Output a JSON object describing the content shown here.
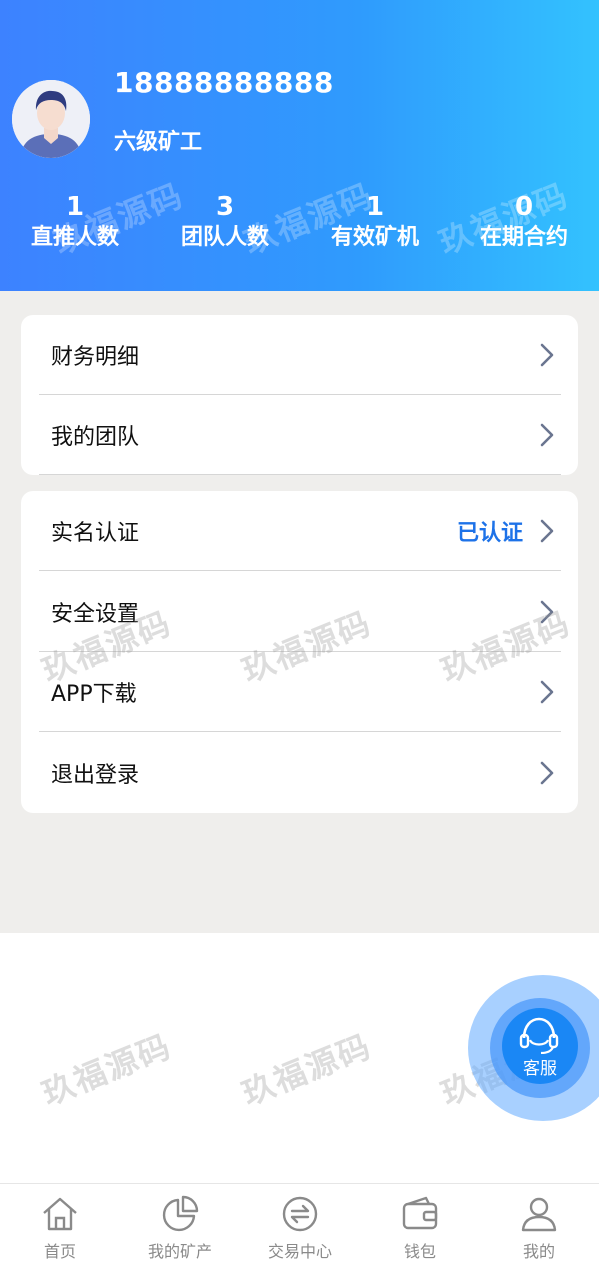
{
  "profile": {
    "phone": "18888888888",
    "level": "六级矿工"
  },
  "stats": [
    {
      "value": "1",
      "label": "直推人数"
    },
    {
      "value": "3",
      "label": "团队人数"
    },
    {
      "value": "1",
      "label": "有效矿机"
    },
    {
      "value": "0",
      "label": "在期合约"
    }
  ],
  "menu_group_1": [
    {
      "label": "财务明细"
    },
    {
      "label": "我的团队"
    }
  ],
  "menu_group_2": [
    {
      "label": "实名认证",
      "value": "已认证"
    },
    {
      "label": "安全设置"
    },
    {
      "label": "APP下载"
    },
    {
      "label": "退出登录"
    }
  ],
  "customer_service": {
    "label": "客服"
  },
  "watermark": "玖福源码",
  "tabbar": [
    {
      "label": "首页",
      "icon": "home-icon"
    },
    {
      "label": "我的矿产",
      "icon": "pie-chart-icon"
    },
    {
      "label": "交易中心",
      "icon": "exchange-icon"
    },
    {
      "label": "钱包",
      "icon": "wallet-icon"
    },
    {
      "label": "我的",
      "icon": "user-icon"
    }
  ],
  "colors": {
    "header_start": "#3d82ff",
    "header_end": "#33c2fe",
    "accent": "#1d72e8",
    "tab_gray": "#8a8a8a"
  }
}
